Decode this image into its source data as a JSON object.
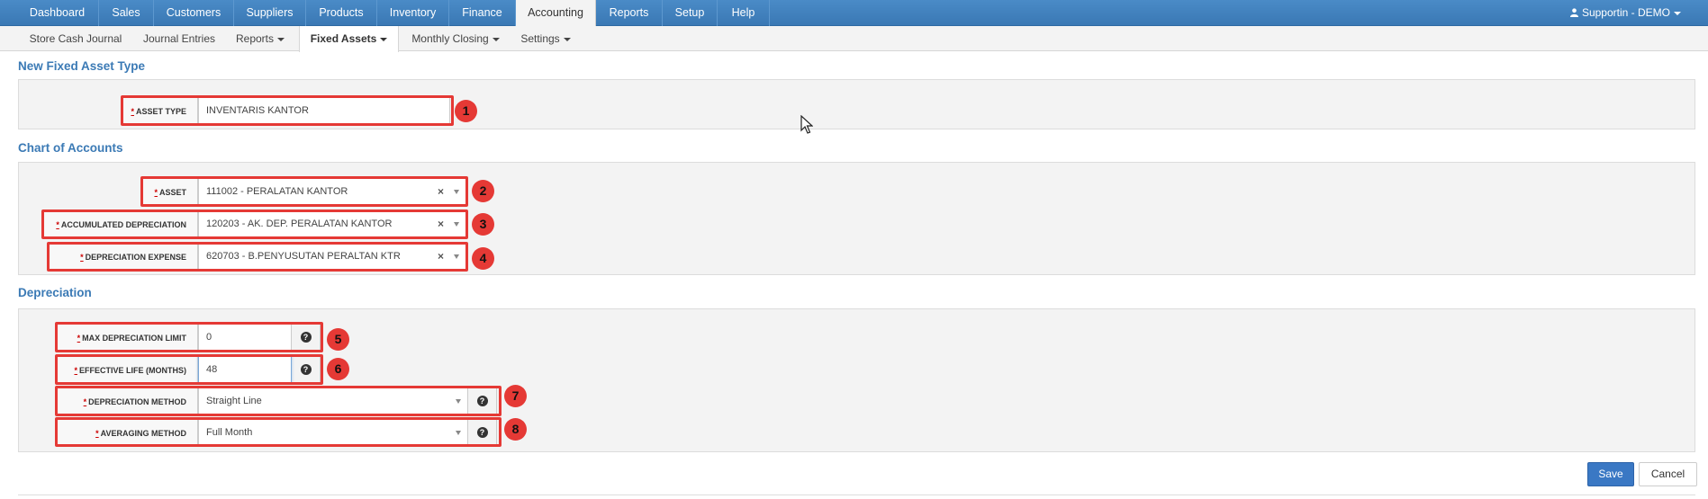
{
  "topnav": {
    "tabs": [
      "Dashboard",
      "Sales",
      "Customers",
      "Suppliers",
      "Products",
      "Inventory",
      "Finance",
      "Accounting",
      "Reports",
      "Setup",
      "Help"
    ],
    "active": "Accounting",
    "user_label": "Supportin - DEMO"
  },
  "subnav": {
    "items": [
      "Store Cash Journal",
      "Journal Entries",
      "Reports",
      "Fixed Assets",
      "Monthly Closing",
      "Settings"
    ],
    "active": "Fixed Assets"
  },
  "sections": {
    "asset_type": "New Fixed Asset Type",
    "chart_of_accounts": "Chart of Accounts",
    "depreciation": "Depreciation"
  },
  "fields": {
    "asset_type": {
      "label": "ASSET TYPE",
      "value": "INVENTARIS KANTOR"
    },
    "asset": {
      "label": "ASSET",
      "value": "111002 - PERALATAN KANTOR"
    },
    "accumulated_depreciation": {
      "label": "ACCUMULATED DEPRECIATION",
      "value": "120203 - AK. DEP. PERALATAN KANTOR"
    },
    "depreciation_expense": {
      "label": "DEPRECIATION EXPENSE",
      "value": "620703 - B.PENYUSUTAN PERALTAN KTR"
    },
    "max_depreciation_limit": {
      "label": "MAX DEPRECIATION LIMIT",
      "value": "0"
    },
    "effective_life": {
      "label": "EFFECTIVE LIFE (MONTHS)",
      "value": "48"
    },
    "depreciation_method": {
      "label": "DEPRECIATION METHOD",
      "value": "Straight Line"
    },
    "averaging_method": {
      "label": "AVERAGING METHOD",
      "value": "Full Month"
    }
  },
  "required_mark": "*",
  "clear_glyph": "×",
  "help_glyph": "?",
  "annotations": [
    "1",
    "2",
    "3",
    "4",
    "5",
    "6",
    "7",
    "8"
  ],
  "buttons": {
    "save": "Save",
    "cancel": "Cancel"
  },
  "colors": {
    "nav_blue": "#3a78b4",
    "section_title": "#3b7ab5",
    "annotation_red": "#e53935",
    "save_button": "#3a78c4"
  }
}
